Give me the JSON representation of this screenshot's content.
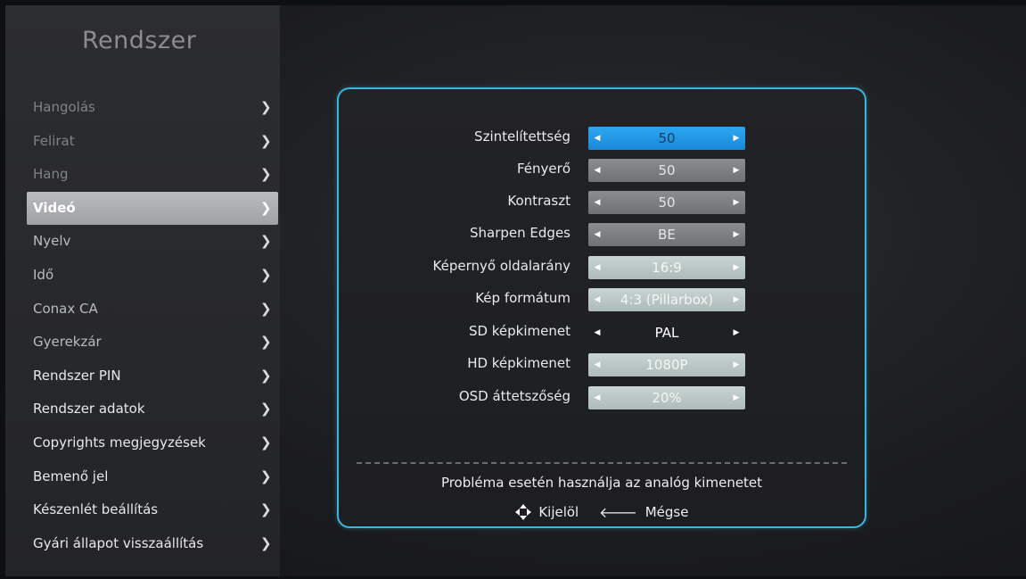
{
  "sidebar": {
    "title": "Rendszer",
    "items": [
      {
        "label": "Hangolás",
        "chevron": "❯"
      },
      {
        "label": "Felirat",
        "chevron": "❯"
      },
      {
        "label": "Hang",
        "chevron": "❯"
      },
      {
        "label": "Videó",
        "chevron": "❯"
      },
      {
        "label": "Nyelv",
        "chevron": "❯"
      },
      {
        "label": "Idő",
        "chevron": "❯"
      },
      {
        "label": "Conax CA",
        "chevron": "❯"
      },
      {
        "label": "Gyerekzár",
        "chevron": "❯"
      },
      {
        "label": "Rendszer PIN",
        "chevron": "❯"
      },
      {
        "label": "Rendszer adatok",
        "chevron": "❯"
      },
      {
        "label": "Copyrights megjegyzések",
        "chevron": "❯"
      },
      {
        "label": "Bemenő jel",
        "chevron": "❯"
      },
      {
        "label": "Készenlét beállítás",
        "chevron": "❯"
      },
      {
        "label": "Gyári állapot visszaállítás",
        "chevron": "❯"
      }
    ],
    "active_index": 3
  },
  "settings": [
    {
      "label": "Szintelítettség",
      "value": "50"
    },
    {
      "label": "Fényerő",
      "value": "50"
    },
    {
      "label": "Kontraszt",
      "value": "50"
    },
    {
      "label": "Sharpen Edges",
      "value": "BE"
    },
    {
      "label": "Képernyő oldalarány",
      "value": "16:9"
    },
    {
      "label": "Kép formátum",
      "value": "4:3 (Pillarbox)"
    },
    {
      "label": "SD képkimenet",
      "value": "PAL"
    },
    {
      "label": "HD képkimenet",
      "value": "1080P"
    },
    {
      "label": "OSD áttetszőség",
      "value": "20%"
    }
  ],
  "arrows": {
    "left": "◀",
    "right": "▶"
  },
  "footer": {
    "hint": "Probléma esetén használja az analóg kimenetet",
    "select_label": "Kijelöl",
    "back_symbol": "🡐",
    "back_label": "Mégse"
  },
  "colors": {
    "accent": "#3bb5e0",
    "selected": "#1a8ad8"
  }
}
